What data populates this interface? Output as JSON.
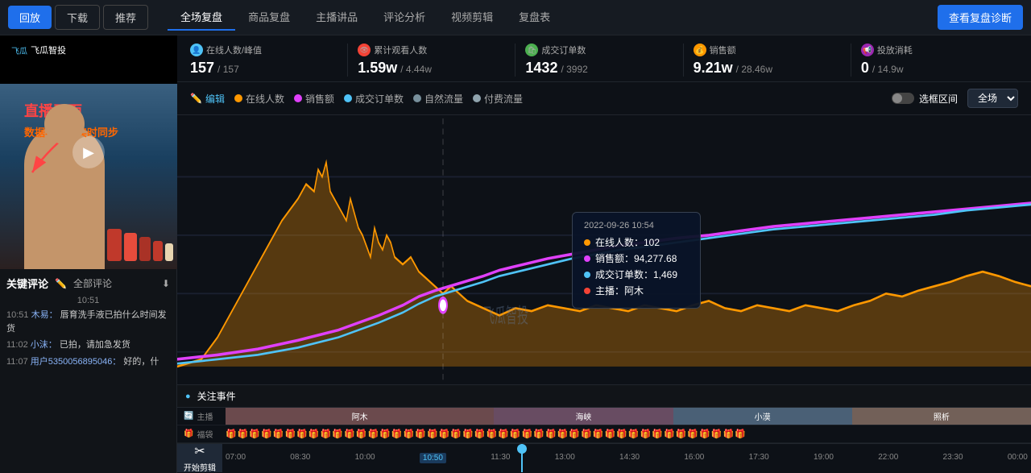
{
  "nav": {
    "btn_playback": "回放",
    "btn_download": "下载",
    "btn_recommend": "推荐",
    "tab_full": "全场复盘",
    "tab_product": "商品复盘",
    "tab_host": "主播讲品",
    "tab_comment": "评论分析",
    "tab_edit": "视频剪辑",
    "tab_summary": "复盘表",
    "diagnose_btn": "查看复盘诊断"
  },
  "stats": [
    {
      "icon": "👤",
      "icon_color": "#4fc3f7",
      "label": "在线人数/峰值",
      "value": "157",
      "sub": "/ 157"
    },
    {
      "icon": "👁",
      "icon_color": "#f44336",
      "label": "累计观看人数",
      "value": "1.59w",
      "sub": "/ 4.44w"
    },
    {
      "icon": "🛍",
      "icon_color": "#4caf50",
      "label": "成交订单数",
      "value": "1432",
      "sub": "/ 3992"
    },
    {
      "icon": "💰",
      "icon_color": "#ff9800",
      "label": "销售额",
      "value": "9.21w",
      "sub": "/ 28.46w"
    },
    {
      "icon": "📢",
      "icon_color": "#9c27b0",
      "label": "投放消耗",
      "value": "0",
      "sub": "/ 14.9w"
    }
  ],
  "chart_controls": {
    "edit_label": "编辑",
    "online_label": "在线人数",
    "sales_label": "销售额",
    "orders_label": "成交订单数",
    "natural_label": "自然流量",
    "paid_label": "付费流量",
    "range_label": "选框区间",
    "scene_default": "全场"
  },
  "tooltip": {
    "time": "2022-09-26 10:54",
    "online": "在线人数：102",
    "sales": "销售额：94,277.68",
    "orders": "成交订单数：1,469",
    "host": "主播：阿木",
    "online_color": "#ff9800",
    "sales_color": "#e040fb",
    "orders_color": "#4fc3f7",
    "host_color": "#f44336"
  },
  "annotation": {
    "title": "直播画面",
    "subtitle": "数据与画面实时同步"
  },
  "video": {
    "watermark": "飞瓜智投"
  },
  "comments": {
    "key_label": "关键评论",
    "all_label": "全部评论",
    "time": "10:51",
    "items": [
      {
        "time": "10:51",
        "user": "木易：",
        "text": "唇育洗手液已拍什么时间发货"
      },
      {
        "time": "11:02",
        "user": "小沫：",
        "text": "已拍，请加急发货"
      },
      {
        "time": "11:07",
        "user": "用户5350056895046：",
        "text": "好的，什"
      }
    ]
  },
  "events": {
    "label": "关注事件",
    "hosts": [
      {
        "name": "阿木",
        "color": "#e8a0a0",
        "flex": 3
      },
      {
        "name": "海峡",
        "color": "#c0a0d0",
        "flex": 2
      },
      {
        "name": "小漠",
        "color": "#a0b8d0",
        "flex": 2
      },
      {
        "name": "照析",
        "color": "#d0b0a0",
        "flex": 2
      }
    ]
  },
  "timeline": {
    "scissors_label": "开始剪辑",
    "times": [
      "07:00",
      "08:30",
      "10:00",
      "10:50",
      "11:30",
      "13:00",
      "14:30",
      "16:00",
      "17:30",
      "19:00",
      "22:00",
      "23:30",
      "00:00"
    ],
    "active_time": "10:50"
  }
}
